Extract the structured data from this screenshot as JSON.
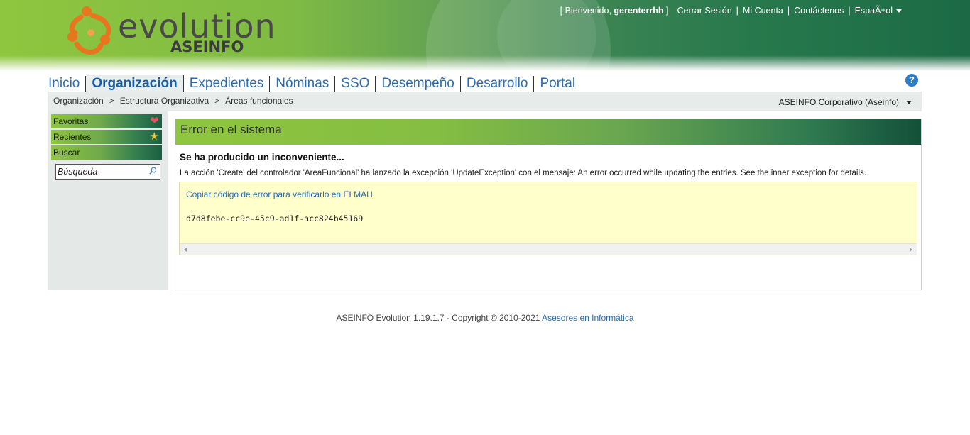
{
  "header": {
    "logo_word": "evolution",
    "logo_sub": "ASEINFO",
    "welcome_prefix": "[ Bienvenido,",
    "welcome_user": "gerenterrhh",
    "welcome_suffix": "]",
    "logout": "Cerrar Sesión",
    "account": "Mi Cuenta",
    "contact": "Contáctenos",
    "language": "EspaÃ±ol",
    "separator": "|"
  },
  "nav": {
    "items": [
      {
        "label": "Inicio"
      },
      {
        "label": "Organización",
        "active": true
      },
      {
        "label": "Expedientes"
      },
      {
        "label": "Nóminas"
      },
      {
        "label": "SSO"
      },
      {
        "label": "Desempeño"
      },
      {
        "label": "Desarrollo"
      },
      {
        "label": "Portal"
      }
    ],
    "help_icon": "question-circle-icon",
    "help_glyph": "?"
  },
  "breadcrumb": {
    "items": [
      "Organización",
      "Estructura Organizativa",
      "Áreas funcionales"
    ],
    "separator": ">",
    "company": "ASEINFO Corporativo (Aseinfo)"
  },
  "sidebar": {
    "favorites": "Favoritas",
    "recent": "Recientes",
    "search_header": "Buscar",
    "search_placeholder": "Búsqueda",
    "icons": {
      "favorites": "heart-icon",
      "recent": "star-icon",
      "search": "magnifier-icon"
    }
  },
  "panel": {
    "title": "Error en el sistema",
    "error_heading": "Se ha producido un inconveniente...",
    "error_message": "La acción 'Create' del controlador 'AreaFuncional' ha lanzado la excepción 'UpdateException' con el mensaje: An error occurred while updating the entries. See the inner exception for details.",
    "copy_link": "Copiar código de error para verificarlo en ELMAH",
    "error_code": "d7d8febe-cc9e-45c9-ad1f-acc824b45169"
  },
  "footer": {
    "text": "ASEINFO Evolution 1.19.1.7 - Copyright © 2010-2021",
    "link": "Asesores en Informática"
  },
  "colors": {
    "brand_green": "#8fc63f",
    "dark_green": "#1b6a45",
    "link_blue": "#2a6db5",
    "code_bg": "#ffffcc"
  }
}
